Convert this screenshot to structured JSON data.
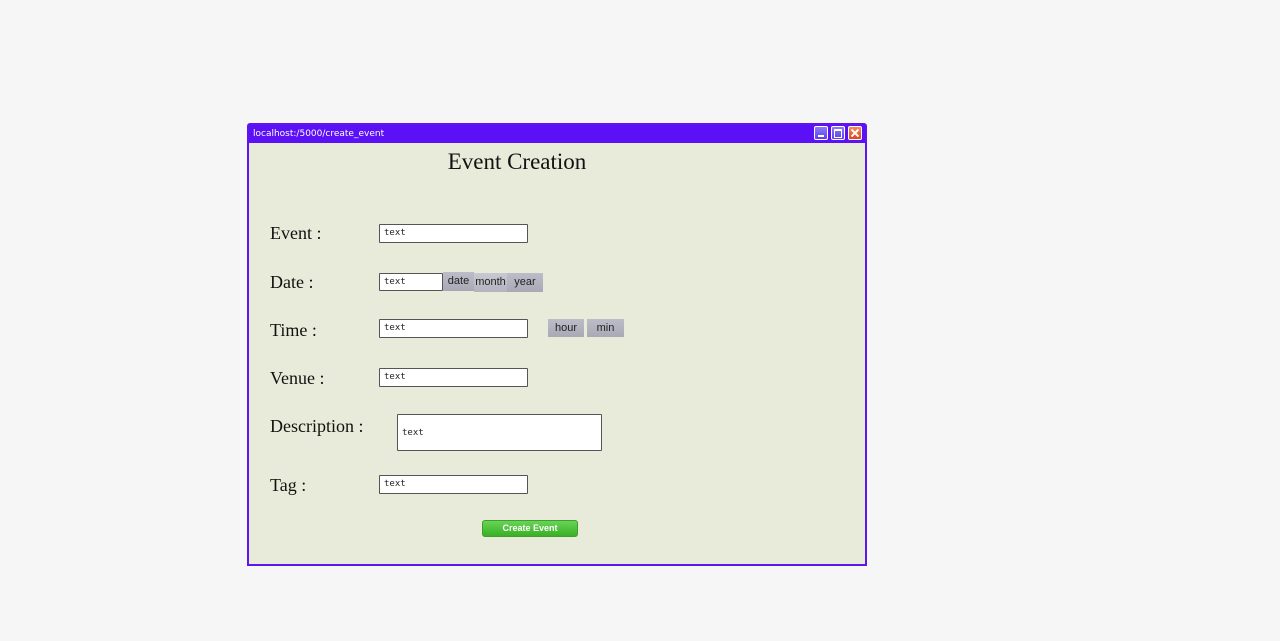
{
  "window": {
    "url": "localhost:/5000/create_event",
    "title_bar_color": "#5b10f6",
    "background": "#e8ebd9"
  },
  "page": {
    "title": "Event Creation"
  },
  "form": {
    "event": {
      "label": "Event :",
      "value": "text"
    },
    "date": {
      "label": "Date :",
      "value": "text",
      "date_button": "date",
      "month_button": "month",
      "year_button": "year"
    },
    "time": {
      "label": "Time :",
      "value": "text",
      "hour_button": "hour",
      "min_button": "min"
    },
    "venue": {
      "label": "Venue :",
      "value": "text"
    },
    "description": {
      "label": "Description :",
      "value": "text"
    },
    "tag": {
      "label": "Tag :",
      "value": "text"
    }
  },
  "actions": {
    "create_label": "Create Event",
    "create_color": "#38b024"
  },
  "icons": [
    "minimize-icon",
    "maximize-icon",
    "close-icon"
  ]
}
